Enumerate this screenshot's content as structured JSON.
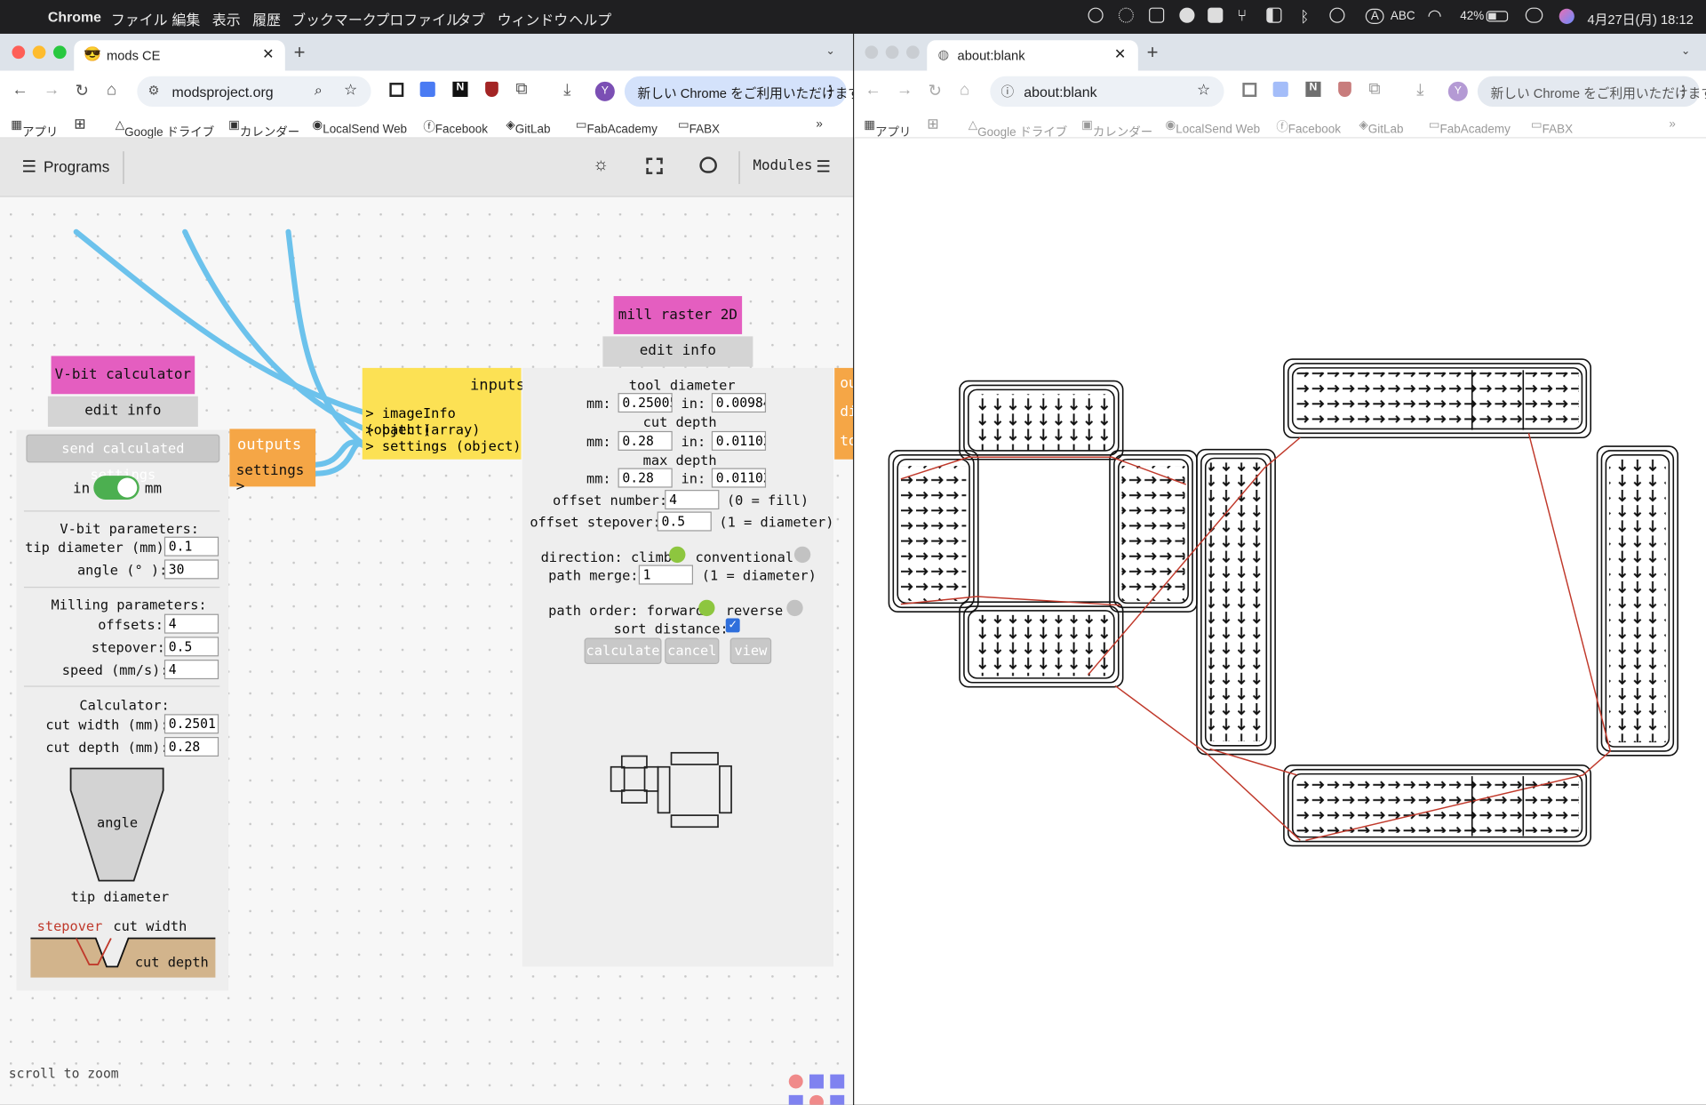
{
  "menubar": {
    "app": "Chrome",
    "items": [
      "ファイル",
      "編集",
      "表示",
      "履歴",
      "ブックマーク",
      "プロファイル",
      "タブ",
      "ウィンドウ",
      "ヘルプ"
    ],
    "input_source": "ABC",
    "battery": "42%",
    "datetime": "4月27日(月) 18:12",
    "icons": [
      "apple-icon",
      "sync-icon",
      "airplay-icon",
      "screen-icon",
      "zip-icon",
      "drive-icon",
      "fork-icon",
      "panel-icon",
      "bluetooth-icon",
      "emoji-icon",
      "input-icon",
      "wifi-icon",
      "battery-icon",
      "control-center-icon",
      "siri-icon"
    ]
  },
  "left_window": {
    "tab_title": "mods CE",
    "url": "modsproject.org",
    "update_button": "新しい Chrome をご利用いただけます",
    "profile_initial": "Y",
    "bookmarks": [
      "アプリ",
      "Google ドライブ",
      "カレンダー",
      "LocalSend Web",
      "Facebook",
      "GitLab",
      "FabAcademy",
      "FABX"
    ]
  },
  "right_window": {
    "tab_title": "about:blank",
    "url": "about:blank",
    "update_button": "新しい Chrome をご利用いただけます",
    "profile_initial": "Y",
    "bookmarks": [
      "アプリ",
      "Google ドライブ",
      "カレンダー",
      "LocalSend Web",
      "Facebook",
      "GitLab",
      "FabAcademy",
      "FABX"
    ]
  },
  "mods": {
    "programs_label": "Programs",
    "modules_label": "Modules",
    "scroll_hint": "scroll to zoom",
    "vbit": {
      "title": "V-bit calculator",
      "edit": "edit info collapse",
      "send_button": "send calculated settings",
      "toggle_in": "in",
      "toggle_mm": "mm",
      "outputs_title": "outputs",
      "outputs_settings": "settings >",
      "vbit_params": "V-bit parameters:",
      "tip_label": "tip diameter (mm):",
      "tip_value": "0.1",
      "angle_label": "angle (° ):",
      "angle_value": "30",
      "milling_params": "Milling parameters:",
      "offsets_label": "offsets:",
      "offsets_value": "4",
      "stepover_label": "stepover:",
      "stepover_value": "0.5",
      "speed_label": "speed (mm/s):",
      "speed_value": "4",
      "calculator": "Calculator:",
      "cutwidth_label": "cut width (mm):",
      "cutwidth_value": "0.2501",
      "cutdepth_label": "cut depth (mm):",
      "cutdepth_value": "0.28",
      "diag_angle": "angle",
      "diag_tip": "tip diameter",
      "diag_stepover": "stepover",
      "diag_cutwidth": "cut width",
      "diag_cutdepth": "cut depth"
    },
    "mill": {
      "title": "mill raster 2D",
      "edit": "edit info collapse",
      "inputs_title": "inputs",
      "inputs": [
        "> imageInfo (object)",
        "> path (array)",
        "> settings (object)"
      ],
      "tool_diameter": "tool diameter",
      "mm": "mm:",
      "in": "in:",
      "tool_mm": "0.25005",
      "tool_in": "0.00984",
      "cut_depth": "cut depth",
      "cut_mm": "0.28",
      "cut_in": "0.01102",
      "max_depth": "max depth",
      "max_mm": "0.28",
      "max_in": "0.01102",
      "offset_number_label": "offset number:",
      "offset_number": "4",
      "offset_number_hint": "(0 = fill)",
      "offset_stepover_label": "offset stepover:",
      "offset_stepover": "0.5",
      "offset_stepover_hint": "(1 = diameter)",
      "direction_label": "direction: climb",
      "conventional": "conventional",
      "path_merge_label": "path merge:",
      "path_merge": "1",
      "path_merge_hint": "(1 = diameter)",
      "path_order_label": "path order: forward",
      "reverse": "reverse",
      "sort_distance": "sort distance:",
      "calculate": "calculate",
      "cancel": "cancel",
      "view": "view",
      "next_module_partial": [
        "ou",
        "di",
        "to"
      ]
    }
  },
  "colors": {
    "module_title": "#e45ec0",
    "inputs": "#fce154",
    "outputs": "#f5a646",
    "wire": "#6cc2ec",
    "radio_on": "#8dc63f",
    "toggle": "#4caf50",
    "toolpath_link": "#c0392b"
  }
}
